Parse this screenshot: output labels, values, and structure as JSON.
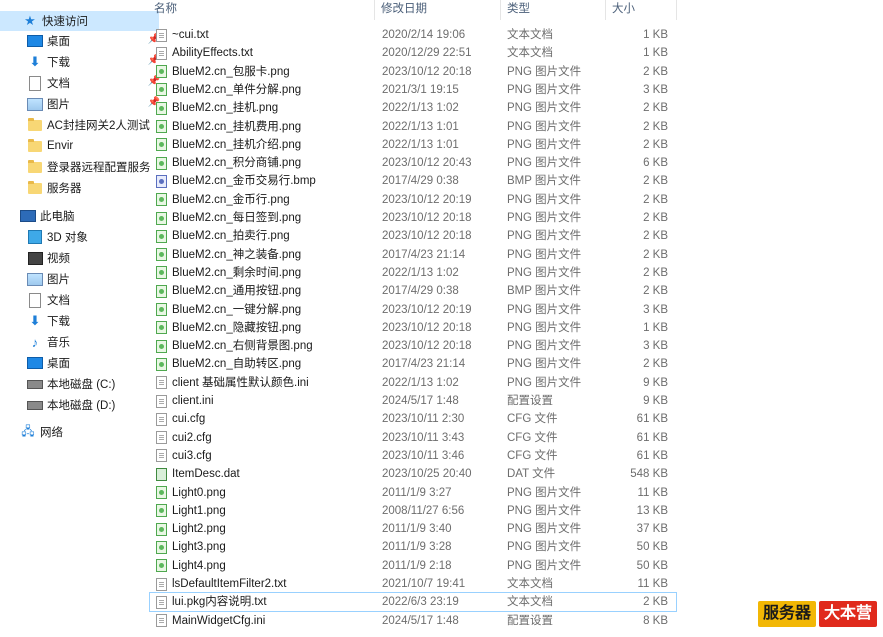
{
  "nav": {
    "quick_access": {
      "label": "快速访问",
      "icon": "star-icon"
    },
    "pinned": [
      {
        "label": "桌面",
        "icon": "desktop-icon"
      },
      {
        "label": "下载",
        "icon": "download-icon"
      },
      {
        "label": "文档",
        "icon": "document-icon"
      },
      {
        "label": "图片",
        "icon": "pictures-icon"
      }
    ],
    "folders": [
      {
        "label": "AC封挂网关2人测试"
      },
      {
        "label": "Envir"
      },
      {
        "label": "登录器远程配置服务"
      },
      {
        "label": "服务器"
      }
    ],
    "this_pc": {
      "label": "此电脑"
    },
    "pc_items": [
      {
        "label": "3D 对象",
        "icon": "3d-objects-icon"
      },
      {
        "label": "视频",
        "icon": "video-icon"
      },
      {
        "label": "图片",
        "icon": "pictures-icon"
      },
      {
        "label": "文档",
        "icon": "document-icon"
      },
      {
        "label": "下载",
        "icon": "download-icon"
      },
      {
        "label": "音乐",
        "icon": "music-icon"
      },
      {
        "label": "桌面",
        "icon": "desktop-icon"
      },
      {
        "label": "本地磁盘 (C:)",
        "icon": "drive-icon"
      },
      {
        "label": "本地磁盘 (D:)",
        "icon": "drive-icon"
      }
    ],
    "network": {
      "label": "网络"
    }
  },
  "columns": {
    "name": "名称",
    "date": "修改日期",
    "type": "类型",
    "size": "大小"
  },
  "files": [
    {
      "name": "~cui.txt",
      "date": "2020/2/14 19:06",
      "type": "文本文档",
      "size": "1 KB",
      "kind": "txt"
    },
    {
      "name": "AbilityEffects.txt",
      "date": "2020/12/29 22:51",
      "type": "文本文档",
      "size": "1 KB",
      "kind": "txt"
    },
    {
      "name": "BlueM2.cn_包服卡.png",
      "date": "2023/10/12 20:18",
      "type": "PNG 图片文件",
      "size": "2 KB",
      "kind": "png"
    },
    {
      "name": "BlueM2.cn_单件分解.png",
      "date": "2021/3/1 19:15",
      "type": "PNG 图片文件",
      "size": "3 KB",
      "kind": "png"
    },
    {
      "name": "BlueM2.cn_挂机.png",
      "date": "2022/1/13 1:02",
      "type": "PNG 图片文件",
      "size": "2 KB",
      "kind": "png"
    },
    {
      "name": "BlueM2.cn_挂机费用.png",
      "date": "2022/1/13 1:01",
      "type": "PNG 图片文件",
      "size": "2 KB",
      "kind": "png"
    },
    {
      "name": "BlueM2.cn_挂机介绍.png",
      "date": "2022/1/13 1:01",
      "type": "PNG 图片文件",
      "size": "2 KB",
      "kind": "png"
    },
    {
      "name": "BlueM2.cn_积分商铺.png",
      "date": "2023/10/12 20:43",
      "type": "PNG 图片文件",
      "size": "6 KB",
      "kind": "png"
    },
    {
      "name": "BlueM2.cn_金币交易行.bmp",
      "date": "2017/4/29 0:38",
      "type": "BMP 图片文件",
      "size": "2 KB",
      "kind": "bmp"
    },
    {
      "name": "BlueM2.cn_金币行.png",
      "date": "2023/10/12 20:19",
      "type": "PNG 图片文件",
      "size": "2 KB",
      "kind": "png"
    },
    {
      "name": "BlueM2.cn_每日签到.png",
      "date": "2023/10/12 20:18",
      "type": "PNG 图片文件",
      "size": "2 KB",
      "kind": "png"
    },
    {
      "name": "BlueM2.cn_拍卖行.png",
      "date": "2023/10/12 20:18",
      "type": "PNG 图片文件",
      "size": "2 KB",
      "kind": "png"
    },
    {
      "name": "BlueM2.cn_神之装备.png",
      "date": "2017/4/23 21:14",
      "type": "PNG 图片文件",
      "size": "2 KB",
      "kind": "png"
    },
    {
      "name": "BlueM2.cn_剩余时间.png",
      "date": "2022/1/13 1:02",
      "type": "PNG 图片文件",
      "size": "2 KB",
      "kind": "png"
    },
    {
      "name": "BlueM2.cn_通用按钮.png",
      "date": "2017/4/29 0:38",
      "type": "BMP 图片文件",
      "size": "2 KB",
      "kind": "png"
    },
    {
      "name": "BlueM2.cn_一键分解.png",
      "date": "2023/10/12 20:19",
      "type": "PNG 图片文件",
      "size": "3 KB",
      "kind": "png"
    },
    {
      "name": "BlueM2.cn_隐藏按钮.png",
      "date": "2023/10/12 20:18",
      "type": "PNG 图片文件",
      "size": "1 KB",
      "kind": "png"
    },
    {
      "name": "BlueM2.cn_右侧背景图.png",
      "date": "2023/10/12 20:18",
      "type": "PNG 图片文件",
      "size": "3 KB",
      "kind": "png"
    },
    {
      "name": "BlueM2.cn_自助转区.png",
      "date": "2017/4/23 21:14",
      "type": "PNG 图片文件",
      "size": "2 KB",
      "kind": "png"
    },
    {
      "name": "client 基础属性默认颜色.ini",
      "date": "2022/1/13 1:02",
      "type": "PNG 图片文件",
      "size": "9 KB",
      "kind": "ini"
    },
    {
      "name": "client.ini",
      "date": "2024/5/17 1:48",
      "type": "配置设置",
      "size": "9 KB",
      "kind": "ini"
    },
    {
      "name": "cui.cfg",
      "date": "2023/10/11 2:30",
      "type": "CFG 文件",
      "size": "61 KB",
      "kind": "cfg"
    },
    {
      "name": "cui2.cfg",
      "date": "2023/10/11 3:43",
      "type": "CFG 文件",
      "size": "61 KB",
      "kind": "cfg"
    },
    {
      "name": "cui3.cfg",
      "date": "2023/10/11 3:46",
      "type": "CFG 文件",
      "size": "61 KB",
      "kind": "cfg"
    },
    {
      "name": "ItemDesc.dat",
      "date": "2023/10/25 20:40",
      "type": "DAT 文件",
      "size": "548 KB",
      "kind": "dat"
    },
    {
      "name": "Light0.png",
      "date": "2011/1/9 3:27",
      "type": "PNG 图片文件",
      "size": "11 KB",
      "kind": "png"
    },
    {
      "name": "Light1.png",
      "date": "2008/11/27 6:56",
      "type": "PNG 图片文件",
      "size": "13 KB",
      "kind": "png"
    },
    {
      "name": "Light2.png",
      "date": "2011/1/9 3:40",
      "type": "PNG 图片文件",
      "size": "37 KB",
      "kind": "png"
    },
    {
      "name": "Light3.png",
      "date": "2011/1/9 3:28",
      "type": "PNG 图片文件",
      "size": "50 KB",
      "kind": "png"
    },
    {
      "name": "Light4.png",
      "date": "2011/1/9 2:18",
      "type": "PNG 图片文件",
      "size": "50 KB",
      "kind": "png"
    },
    {
      "name": "lsDefaultItemFilter2.txt",
      "date": "2021/10/7 19:41",
      "type": "文本文档",
      "size": "11 KB",
      "kind": "txt"
    },
    {
      "name": "lui.pkg内容说明.txt",
      "date": "2022/6/3 23:19",
      "type": "文本文档",
      "size": "2 KB",
      "kind": "txt",
      "selected": true
    },
    {
      "name": "MainWidgetCfg.ini",
      "date": "2024/5/17 1:48",
      "type": "配置设置",
      "size": "8 KB",
      "kind": "ini"
    }
  ],
  "badge": {
    "part1": "服务器",
    "part2": "大本营"
  }
}
